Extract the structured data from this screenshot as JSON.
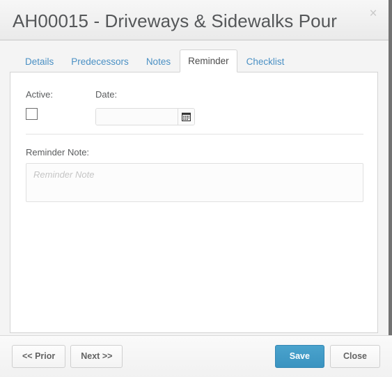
{
  "window": {
    "title": "AH00015 - Driveways & Sidewalks Pour",
    "close_icon": "close-x-icon",
    "close_glyph": "×"
  },
  "tabs": [
    {
      "label": "Details",
      "active": false
    },
    {
      "label": "Predecessors",
      "active": false
    },
    {
      "label": "Notes",
      "active": false
    },
    {
      "label": "Reminder",
      "active": true
    },
    {
      "label": "Checklist",
      "active": false
    }
  ],
  "form": {
    "active": {
      "label": "Active:",
      "checked": false
    },
    "date": {
      "label": "Date:",
      "value": "",
      "placeholder": "",
      "picker_icon": "calendar-icon"
    },
    "reminder_note": {
      "label": "Reminder Note:",
      "value": "",
      "placeholder": "Reminder Note"
    }
  },
  "footer": {
    "prior_label": "<< Prior",
    "next_label": "Next >>",
    "save_label": "Save",
    "close_label": "Close"
  },
  "colors": {
    "accent_blue": "#3a93c0",
    "tab_link": "#4a90c4",
    "title_text": "#555759",
    "label_text": "#5a5c5e",
    "panel_bg": "#ffffff",
    "dialog_bg": "#f4f4f4",
    "scrollbar": "#737373"
  }
}
